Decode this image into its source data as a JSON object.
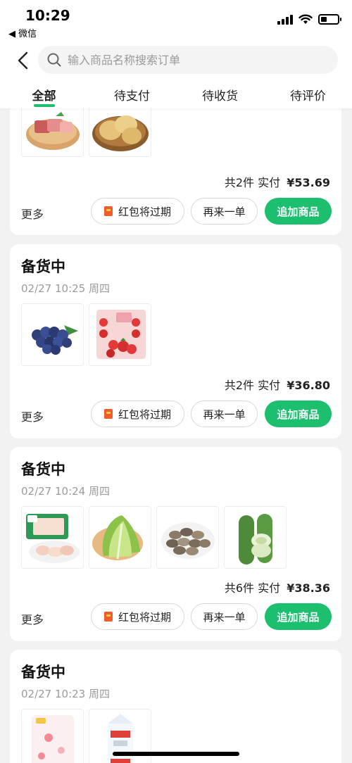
{
  "status_bar": {
    "time": "10:29",
    "back_app": "◀ 微信"
  },
  "search": {
    "placeholder": "输入商品名称搜索订单"
  },
  "tabs": [
    {
      "label": "全部",
      "active": true
    },
    {
      "label": "待支付",
      "active": false
    },
    {
      "label": "待收货",
      "active": false
    },
    {
      "label": "待评价",
      "active": false
    }
  ],
  "colors": {
    "accent": "#1bbf6d",
    "red_packet": "#f15a29"
  },
  "orders": [
    {
      "status": "",
      "time": "",
      "items": [
        "meat-slices",
        "potatoes"
      ],
      "summary_count": "共2件",
      "summary_paid": "实付",
      "summary_amount": "¥53.69"
    },
    {
      "status": "备货中",
      "time": "02/27 10:25 周四",
      "items": [
        "blueberries",
        "strawberries"
      ],
      "summary_count": "共2件",
      "summary_paid": "实付",
      "summary_amount": "¥36.80"
    },
    {
      "status": "备货中",
      "time": "02/27 10:24 周四",
      "items": [
        "chicken-wings",
        "lettuce",
        "clams",
        "loofah"
      ],
      "summary_count": "共6件",
      "summary_paid": "实付",
      "summary_amount": "¥38.36"
    },
    {
      "status": "备货中",
      "time": "02/27 10:23 周四",
      "items": [
        "baby-wipes",
        "milk-carton"
      ],
      "summary_count": "",
      "summary_paid": "",
      "summary_amount": ""
    }
  ],
  "actions": {
    "more": "更多",
    "red_packet": "红包将过期",
    "reorder": "再来一单",
    "add_items": "追加商品"
  }
}
